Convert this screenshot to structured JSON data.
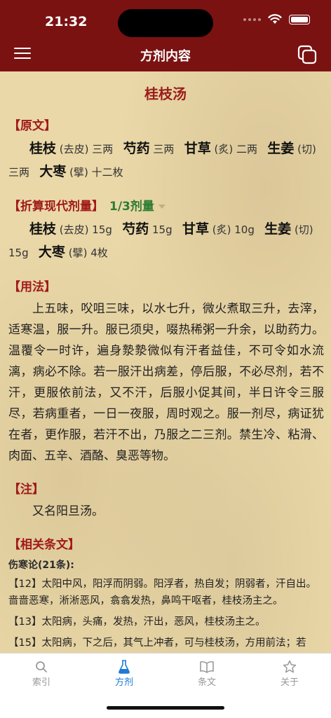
{
  "status": {
    "time": "21:32"
  },
  "nav": {
    "title": "方剂内容"
  },
  "formula": {
    "name": "桂枝汤",
    "original": {
      "heading": "【原文】",
      "herbs": [
        {
          "name": "桂枝",
          "note": "(去皮)",
          "dose": "三两"
        },
        {
          "name": "芍药",
          "note": "",
          "dose": "三两"
        },
        {
          "name": "甘草",
          "note": "(炙)",
          "dose": "二两"
        },
        {
          "name": "生姜",
          "note": "(切)",
          "dose": "三两"
        },
        {
          "name": "大枣",
          "note": "(擘)",
          "dose": "十二枚"
        }
      ]
    },
    "modern": {
      "heading": "【折算现代剂量】",
      "selector": "1/3剂量",
      "herbs": [
        {
          "name": "桂枝",
          "note": "(去皮)",
          "dose": "15g"
        },
        {
          "name": "芍药",
          "note": "",
          "dose": "15g"
        },
        {
          "name": "甘草",
          "note": "(炙)",
          "dose": "10g"
        },
        {
          "name": "生姜",
          "note": "(切)",
          "dose": "15g"
        },
        {
          "name": "大枣",
          "note": "(擘)",
          "dose": "4枚"
        }
      ]
    },
    "usage": {
      "heading": "【用法】",
      "text": "上五味，㕮咀三味，以水七升，微火煮取三升，去滓，适寒温，服一升。服已须臾，啜热稀粥一升余，以助药力。温覆令一时许，遍身漐漐微似有汗者益佳，不可令如水流漓，病必不除。若一服汗出病差，停后服，不必尽剂，若不汗，更服依前法，又不汗，后服小促其间，半日许令三服尽，若病重者，一日一夜服，周时观之。服一剂尽，病证犹在者，更作服，若汗不出，乃服之二三剂。禁生冷、粘滑、肉面、五辛、酒酪、臭恶等物。"
    },
    "note": {
      "heading": "【注】",
      "text": "又名阳旦汤。"
    },
    "related": {
      "heading": "【相关条文】",
      "source": "伤寒论(21条):",
      "clauses": [
        "【12】太阳中风，阳浮而阴弱。阳浮者，热自发；阴弱者，汗自出。啬啬恶寒，淅淅恶风，翕翕发热，鼻鸣干呕者，桂枝汤主之。",
        "【13】太阳病，头痛，发热，汗出，恶风，桂枝汤主之。",
        "【15】太阳病，下之后，其气上冲者，可与桂枝汤，方用前法；若"
      ]
    }
  },
  "tabs": [
    {
      "label": "索引",
      "icon": "search-icon",
      "active": false
    },
    {
      "label": "方剂",
      "icon": "flask-icon",
      "active": true
    },
    {
      "label": "条文",
      "icon": "book-icon",
      "active": false
    },
    {
      "label": "关于",
      "icon": "star-icon",
      "active": false
    }
  ],
  "colors": {
    "header": "#7a1212",
    "section": "#a01a1a",
    "dose_selector": "#2e7d32",
    "tab_active": "#1e7bd6"
  }
}
